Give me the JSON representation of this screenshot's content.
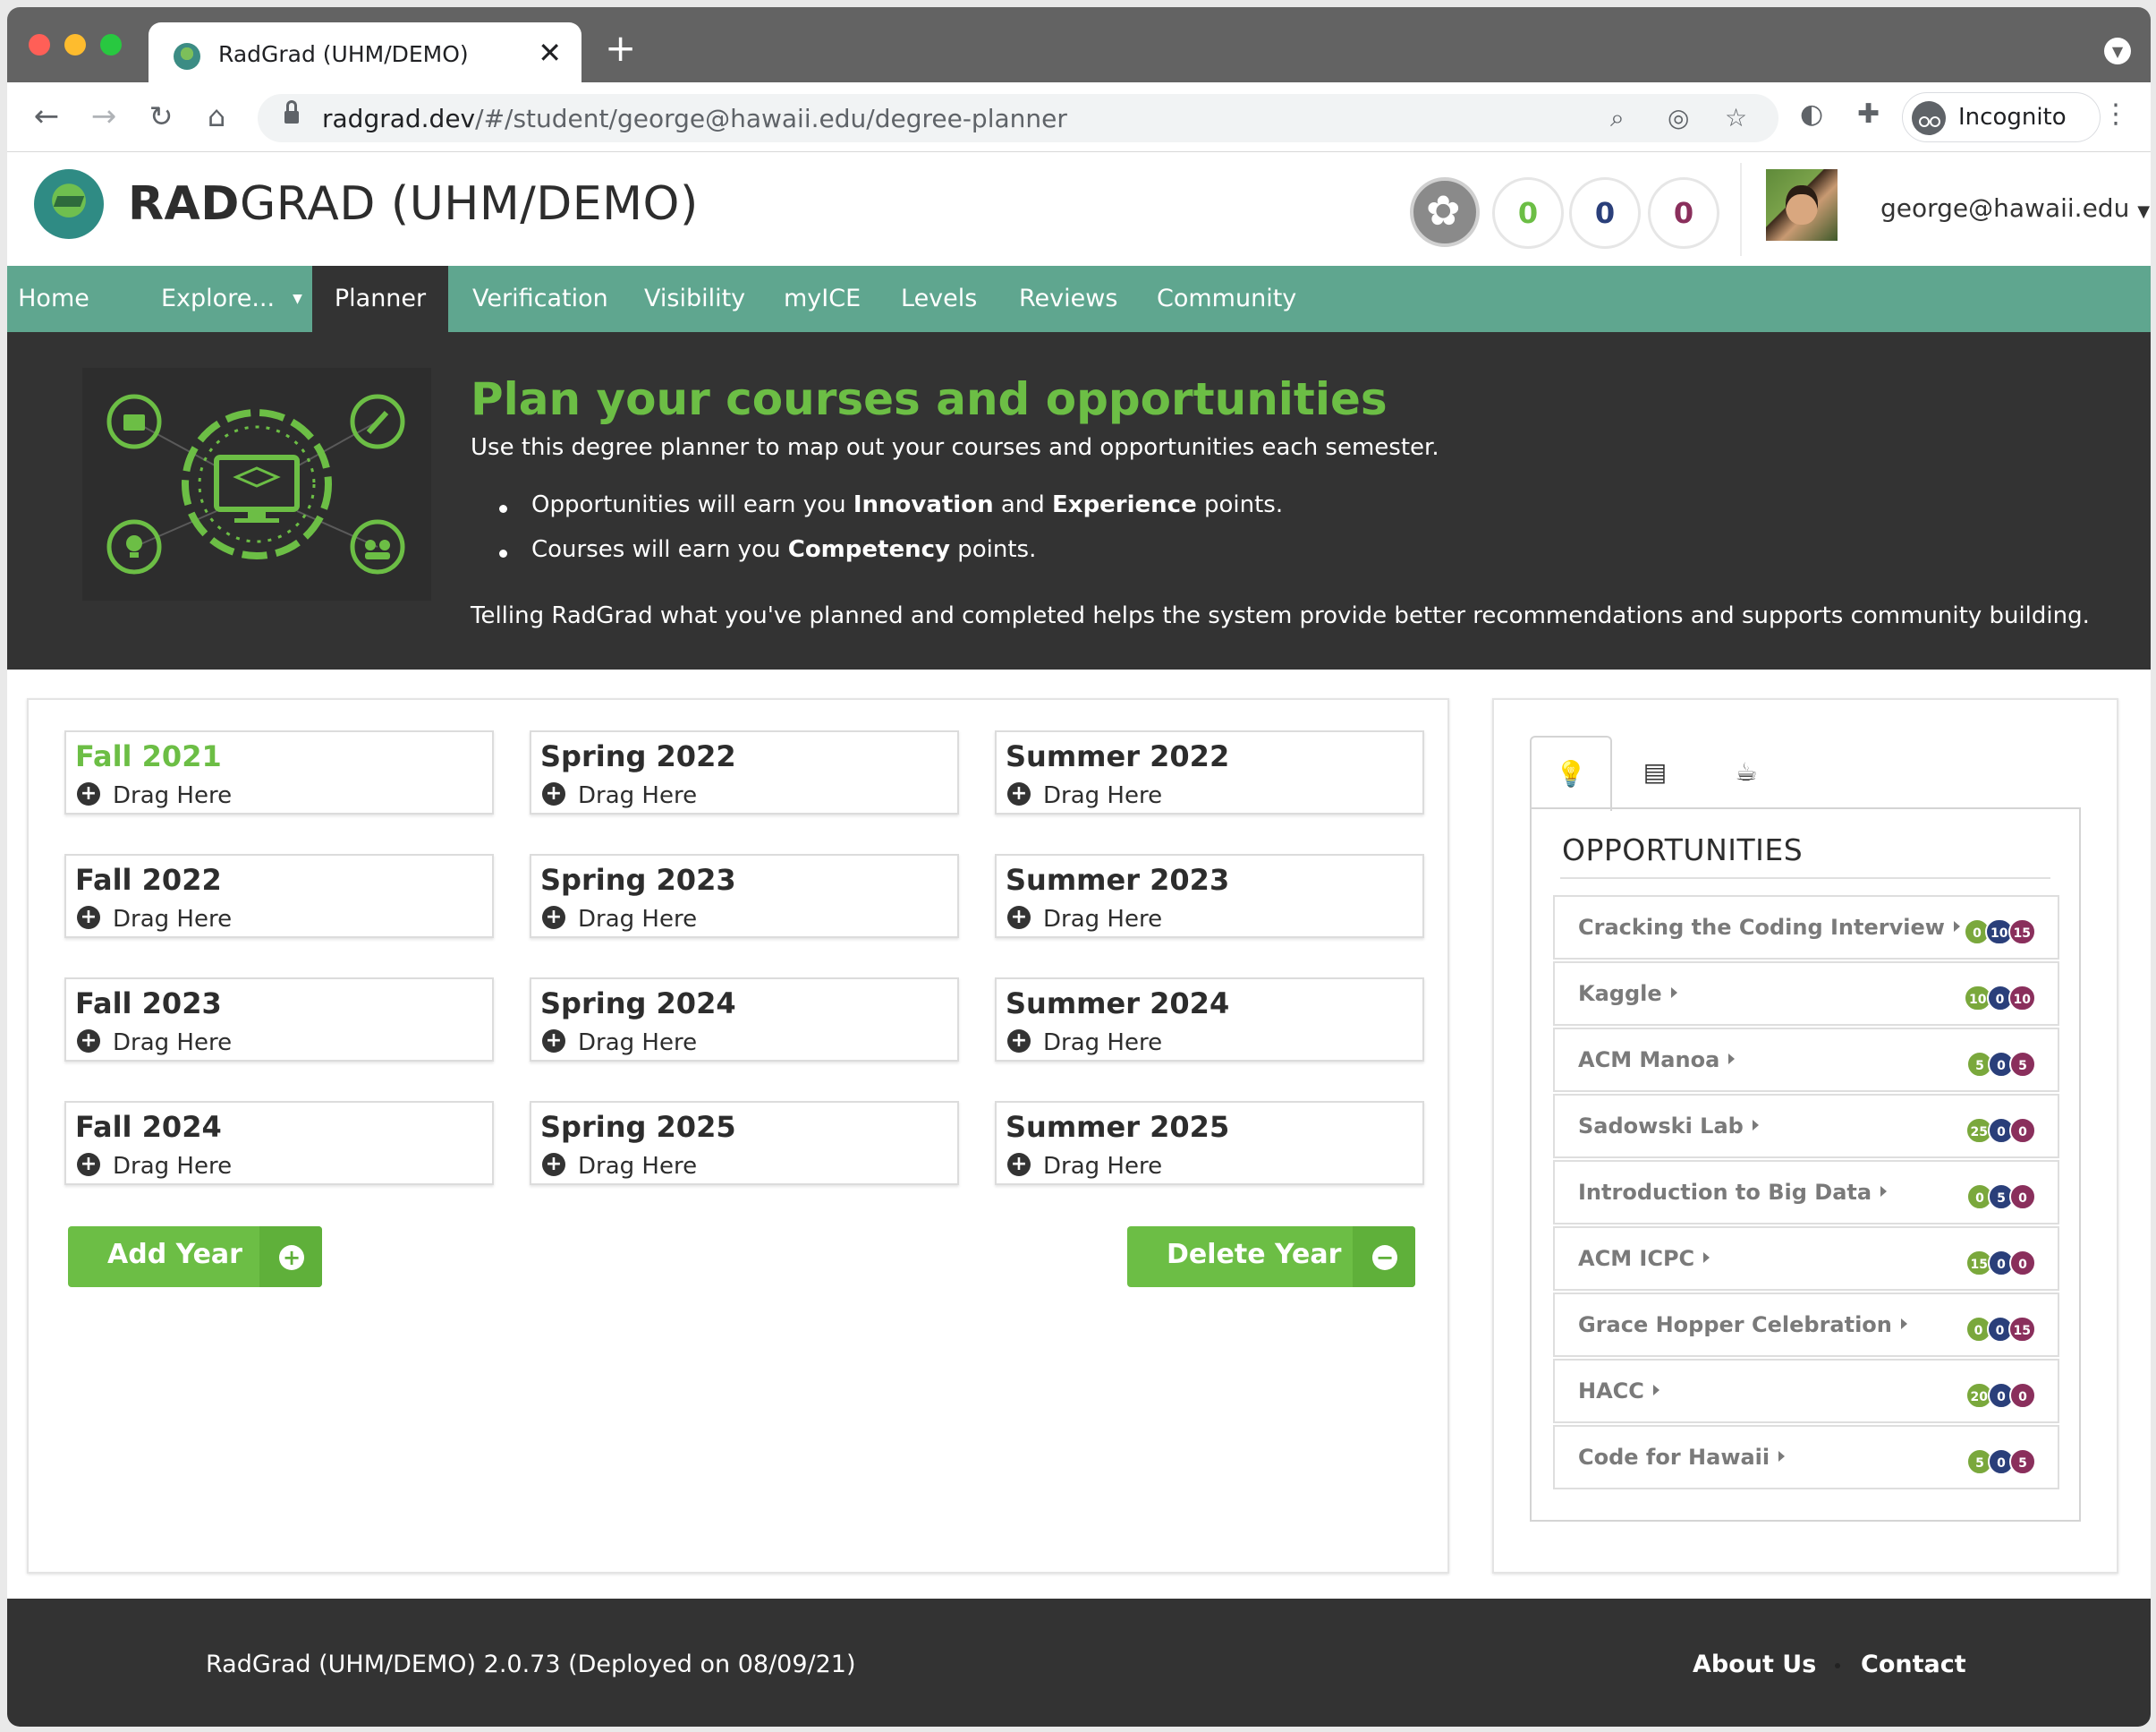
{
  "browser": {
    "tab_title": "RadGrad (UHM/DEMO)",
    "close_glyph": "✕",
    "new_tab_glyph": "+",
    "url_host": "radgrad.dev",
    "url_path": "/#/student/george@hawaii.edu/degree-planner",
    "incognito_label": "Incognito",
    "traffic_colors": [
      "#ff5f57",
      "#febc2e",
      "#28c840"
    ]
  },
  "header": {
    "brand_bold": "RAD",
    "brand_rest": "GRAD (UHM/DEMO)",
    "points": [
      {
        "value": "0",
        "color": "#6cbe45"
      },
      {
        "value": "0",
        "color": "#2a3f7a"
      },
      {
        "value": "0",
        "color": "#8a2f5c"
      }
    ],
    "user_email": "george@hawaii.edu"
  },
  "nav": {
    "items": [
      "Home",
      "Explore...",
      "Planner",
      "Verification",
      "Visibility",
      "myICE",
      "Levels",
      "Reviews",
      "Community"
    ],
    "active": "Planner"
  },
  "banner": {
    "title": "Plan your courses and opportunities",
    "intro": "Use this degree planner to map out your courses and opportunities each semester.",
    "bullet1_pre": "Opportunities will earn you ",
    "bullet1_b1": "Innovation",
    "bullet1_mid": " and ",
    "bullet1_b2": "Experience",
    "bullet1_post": " points.",
    "bullet2_pre": "Courses will earn you ",
    "bullet2_b1": "Competency",
    "bullet2_post": " points.",
    "footer": "Telling RadGrad what you've planned and completed helps the system provide better recommendations and supports community building."
  },
  "planner": {
    "drag_label": "Drag Here",
    "semesters": [
      [
        "Fall 2021",
        "Spring 2022",
        "Summer 2022"
      ],
      [
        "Fall 2022",
        "Spring 2023",
        "Summer 2023"
      ],
      [
        "Fall 2023",
        "Spring 2024",
        "Summer 2024"
      ],
      [
        "Fall 2024",
        "Spring 2025",
        "Summer 2025"
      ]
    ],
    "add_year": "Add Year",
    "delete_year": "Delete Year"
  },
  "opportunities": {
    "title": "OPPORTUNITIES",
    "items": [
      {
        "name": "Cracking the Coding Interview",
        "i": "0",
        "c": "10",
        "e": "15"
      },
      {
        "name": "Kaggle",
        "i": "10",
        "c": "0",
        "e": "10"
      },
      {
        "name": "ACM Manoa",
        "i": "5",
        "c": "0",
        "e": "5"
      },
      {
        "name": "Sadowski Lab",
        "i": "25",
        "c": "0",
        "e": "0"
      },
      {
        "name": "Introduction to Big Data",
        "i": "0",
        "c": "5",
        "e": "0"
      },
      {
        "name": "ACM ICPC",
        "i": "15",
        "c": "0",
        "e": "0"
      },
      {
        "name": "Grace Hopper Celebration",
        "i": "0",
        "c": "0",
        "e": "15"
      },
      {
        "name": "HACC",
        "i": "20",
        "c": "0",
        "e": "0"
      },
      {
        "name": "Code for Hawaii",
        "i": "5",
        "c": "0",
        "e": "5"
      }
    ],
    "badge_colors": {
      "i": "#7aa83c",
      "c": "#2a3f7a",
      "e": "#8a2f5c"
    }
  },
  "footer": {
    "version": "RadGrad (UHM/DEMO) 2.0.73 (Deployed on 08/09/21)",
    "about": "About Us",
    "contact": "Contact"
  }
}
